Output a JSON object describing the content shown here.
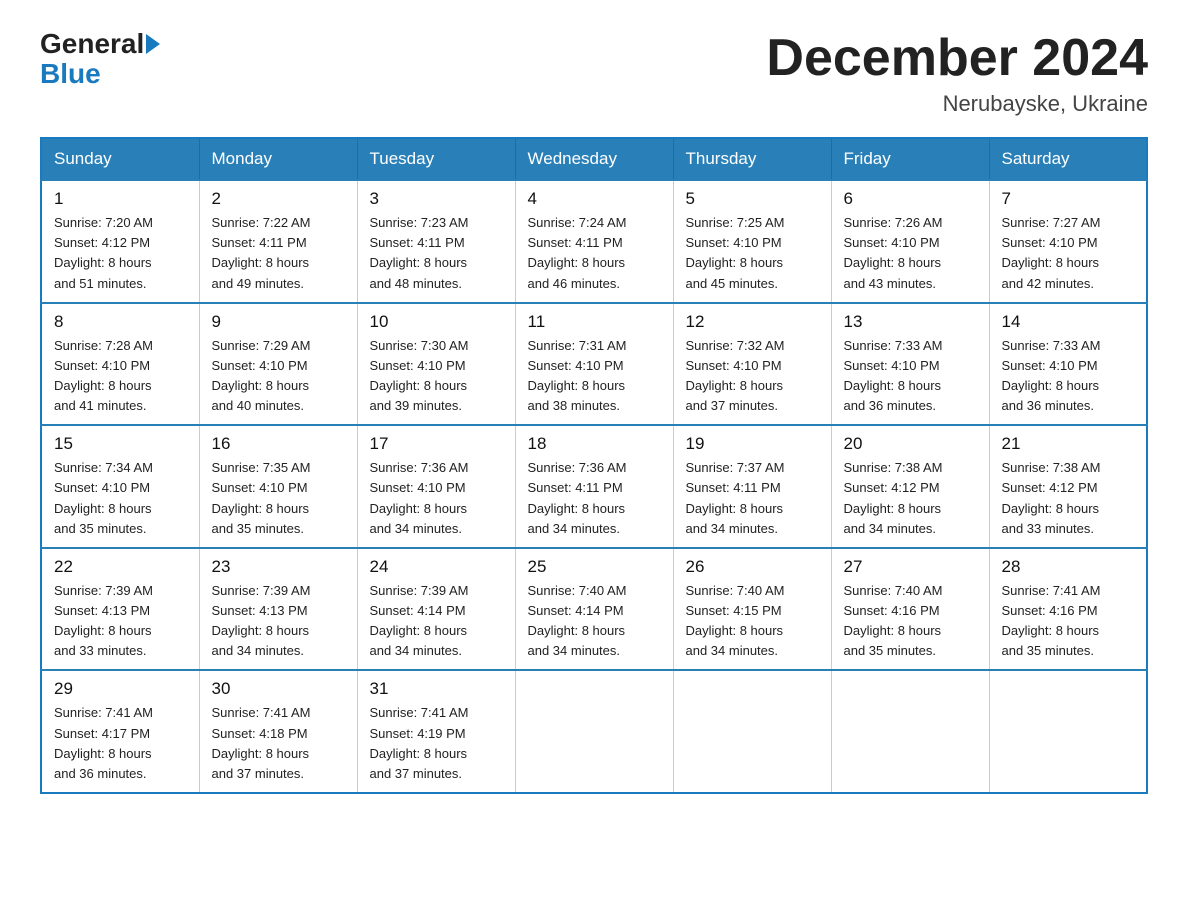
{
  "logo": {
    "general": "General",
    "blue": "Blue"
  },
  "header": {
    "month": "December 2024",
    "location": "Nerubayske, Ukraine"
  },
  "days_of_week": [
    "Sunday",
    "Monday",
    "Tuesday",
    "Wednesday",
    "Thursday",
    "Friday",
    "Saturday"
  ],
  "weeks": [
    [
      {
        "num": "1",
        "sunrise": "7:20 AM",
        "sunset": "4:12 PM",
        "daylight": "8 hours and 51 minutes."
      },
      {
        "num": "2",
        "sunrise": "7:22 AM",
        "sunset": "4:11 PM",
        "daylight": "8 hours and 49 minutes."
      },
      {
        "num": "3",
        "sunrise": "7:23 AM",
        "sunset": "4:11 PM",
        "daylight": "8 hours and 48 minutes."
      },
      {
        "num": "4",
        "sunrise": "7:24 AM",
        "sunset": "4:11 PM",
        "daylight": "8 hours and 46 minutes."
      },
      {
        "num": "5",
        "sunrise": "7:25 AM",
        "sunset": "4:10 PM",
        "daylight": "8 hours and 45 minutes."
      },
      {
        "num": "6",
        "sunrise": "7:26 AM",
        "sunset": "4:10 PM",
        "daylight": "8 hours and 43 minutes."
      },
      {
        "num": "7",
        "sunrise": "7:27 AM",
        "sunset": "4:10 PM",
        "daylight": "8 hours and 42 minutes."
      }
    ],
    [
      {
        "num": "8",
        "sunrise": "7:28 AM",
        "sunset": "4:10 PM",
        "daylight": "8 hours and 41 minutes."
      },
      {
        "num": "9",
        "sunrise": "7:29 AM",
        "sunset": "4:10 PM",
        "daylight": "8 hours and 40 minutes."
      },
      {
        "num": "10",
        "sunrise": "7:30 AM",
        "sunset": "4:10 PM",
        "daylight": "8 hours and 39 minutes."
      },
      {
        "num": "11",
        "sunrise": "7:31 AM",
        "sunset": "4:10 PM",
        "daylight": "8 hours and 38 minutes."
      },
      {
        "num": "12",
        "sunrise": "7:32 AM",
        "sunset": "4:10 PM",
        "daylight": "8 hours and 37 minutes."
      },
      {
        "num": "13",
        "sunrise": "7:33 AM",
        "sunset": "4:10 PM",
        "daylight": "8 hours and 36 minutes."
      },
      {
        "num": "14",
        "sunrise": "7:33 AM",
        "sunset": "4:10 PM",
        "daylight": "8 hours and 36 minutes."
      }
    ],
    [
      {
        "num": "15",
        "sunrise": "7:34 AM",
        "sunset": "4:10 PM",
        "daylight": "8 hours and 35 minutes."
      },
      {
        "num": "16",
        "sunrise": "7:35 AM",
        "sunset": "4:10 PM",
        "daylight": "8 hours and 35 minutes."
      },
      {
        "num": "17",
        "sunrise": "7:36 AM",
        "sunset": "4:10 PM",
        "daylight": "8 hours and 34 minutes."
      },
      {
        "num": "18",
        "sunrise": "7:36 AM",
        "sunset": "4:11 PM",
        "daylight": "8 hours and 34 minutes."
      },
      {
        "num": "19",
        "sunrise": "7:37 AM",
        "sunset": "4:11 PM",
        "daylight": "8 hours and 34 minutes."
      },
      {
        "num": "20",
        "sunrise": "7:38 AM",
        "sunset": "4:12 PM",
        "daylight": "8 hours and 34 minutes."
      },
      {
        "num": "21",
        "sunrise": "7:38 AM",
        "sunset": "4:12 PM",
        "daylight": "8 hours and 33 minutes."
      }
    ],
    [
      {
        "num": "22",
        "sunrise": "7:39 AM",
        "sunset": "4:13 PM",
        "daylight": "8 hours and 33 minutes."
      },
      {
        "num": "23",
        "sunrise": "7:39 AM",
        "sunset": "4:13 PM",
        "daylight": "8 hours and 34 minutes."
      },
      {
        "num": "24",
        "sunrise": "7:39 AM",
        "sunset": "4:14 PM",
        "daylight": "8 hours and 34 minutes."
      },
      {
        "num": "25",
        "sunrise": "7:40 AM",
        "sunset": "4:14 PM",
        "daylight": "8 hours and 34 minutes."
      },
      {
        "num": "26",
        "sunrise": "7:40 AM",
        "sunset": "4:15 PM",
        "daylight": "8 hours and 34 minutes."
      },
      {
        "num": "27",
        "sunrise": "7:40 AM",
        "sunset": "4:16 PM",
        "daylight": "8 hours and 35 minutes."
      },
      {
        "num": "28",
        "sunrise": "7:41 AM",
        "sunset": "4:16 PM",
        "daylight": "8 hours and 35 minutes."
      }
    ],
    [
      {
        "num": "29",
        "sunrise": "7:41 AM",
        "sunset": "4:17 PM",
        "daylight": "8 hours and 36 minutes."
      },
      {
        "num": "30",
        "sunrise": "7:41 AM",
        "sunset": "4:18 PM",
        "daylight": "8 hours and 37 minutes."
      },
      {
        "num": "31",
        "sunrise": "7:41 AM",
        "sunset": "4:19 PM",
        "daylight": "8 hours and 37 minutes."
      },
      null,
      null,
      null,
      null
    ]
  ],
  "labels": {
    "sunrise": "Sunrise:",
    "sunset": "Sunset:",
    "daylight": "Daylight:"
  }
}
